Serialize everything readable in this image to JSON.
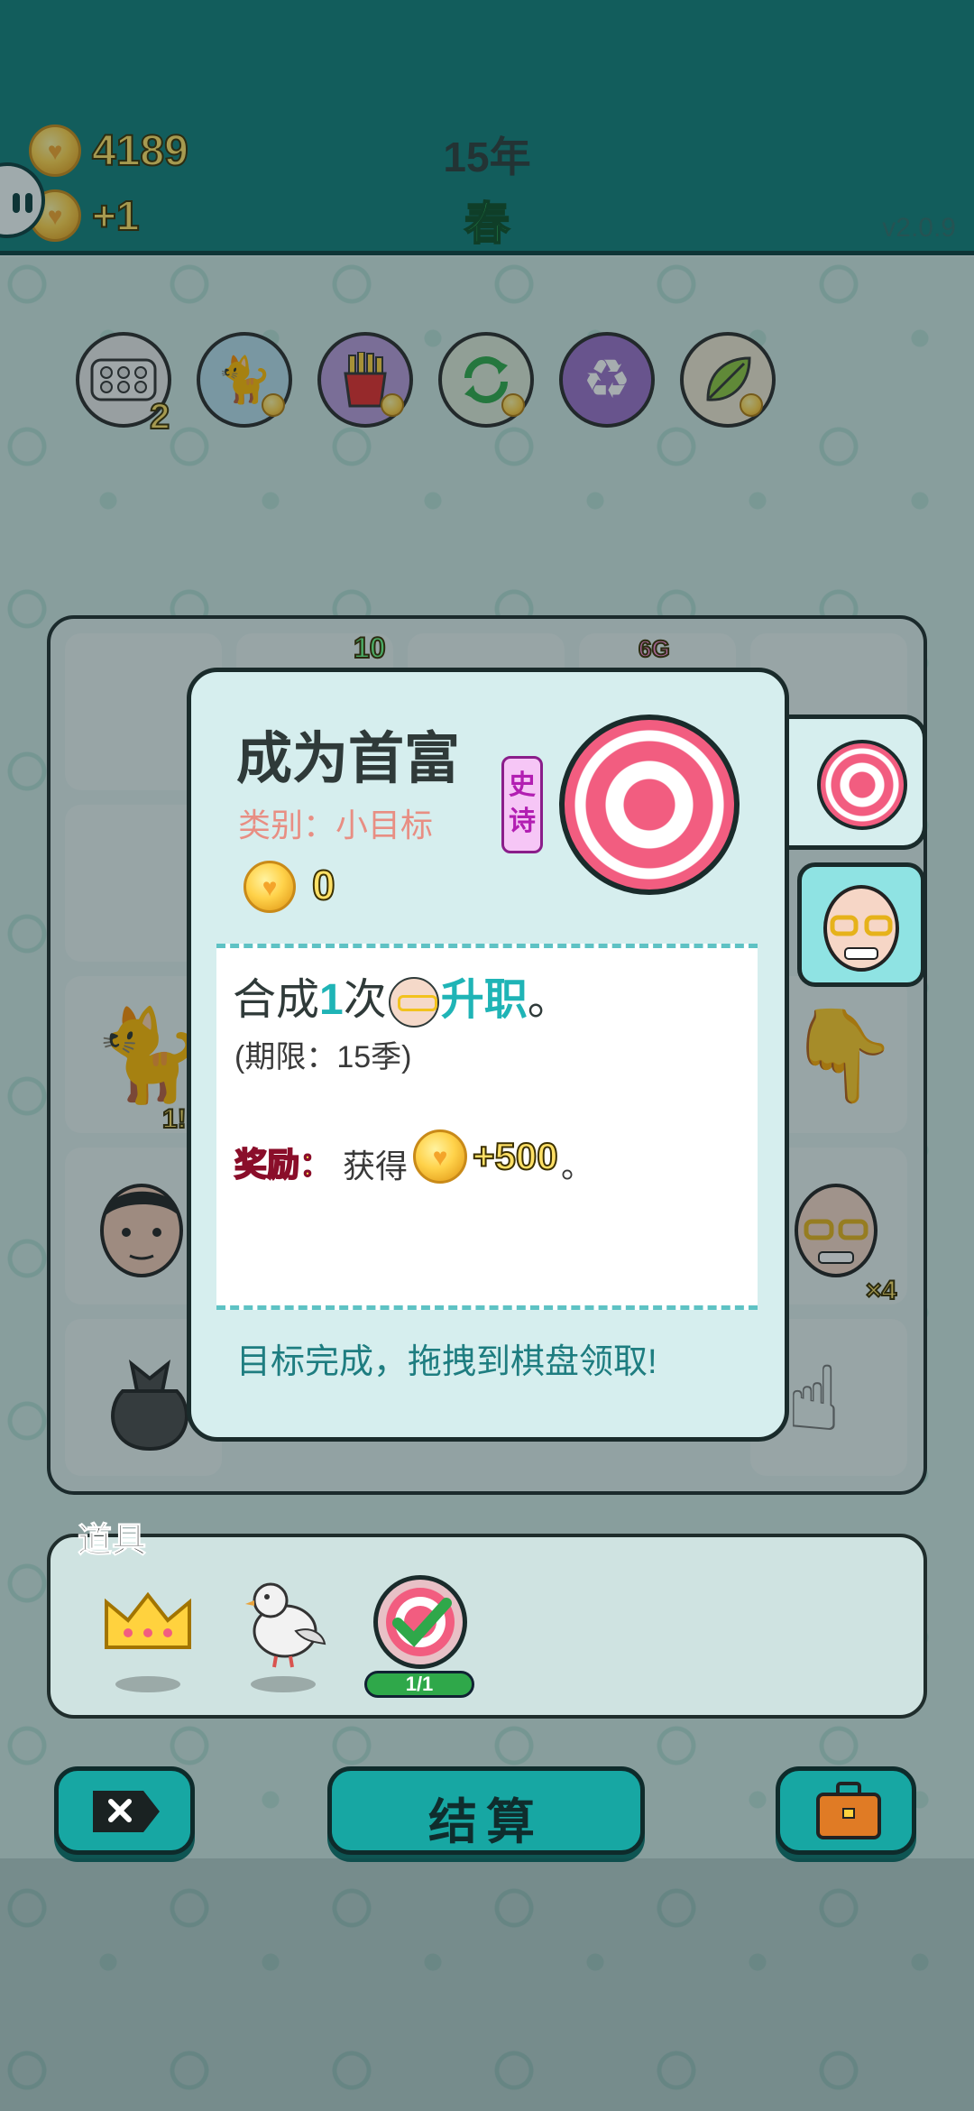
{
  "header": {
    "coins": "4189",
    "income": "+1",
    "year": "15年",
    "season": "春",
    "version": "v2.0.9"
  },
  "toolbar": {
    "items": [
      {
        "name": "egg-tray-icon",
        "badge": "2"
      },
      {
        "name": "cat-icon",
        "badge": ""
      },
      {
        "name": "fries-icon",
        "badge": ""
      },
      {
        "name": "refresh-icon",
        "badge": ""
      },
      {
        "name": "recycle-icon",
        "badge": ""
      },
      {
        "name": "leaf-icon",
        "badge": ""
      }
    ]
  },
  "board": {
    "labels": {
      "top_number": "10",
      "top_tag": "6G",
      "cat_badge": "1!",
      "face_count": "×4"
    }
  },
  "goal_popup": {
    "title": "成为首富",
    "category": "类别：小目标",
    "rarity": "史诗",
    "coin_reward": "0",
    "desc_prefix": "合成",
    "desc_count": "1",
    "desc_times": "次",
    "desc_action": "升职",
    "desc_end": "。",
    "deadline": "(期限：15季)",
    "reward_label": "奖励：",
    "reward_text": "获得",
    "reward_amount": "+500",
    "reward_end": "。",
    "complete_note": "目标完成，拖拽到棋盘领取!"
  },
  "items": {
    "label": "道具",
    "progress": "1/1"
  },
  "bottom": {
    "settle_label": "结算"
  },
  "colors": {
    "teal": "#117e7a",
    "accent": "#1fb4b6",
    "target_pink": "#f25d80"
  }
}
